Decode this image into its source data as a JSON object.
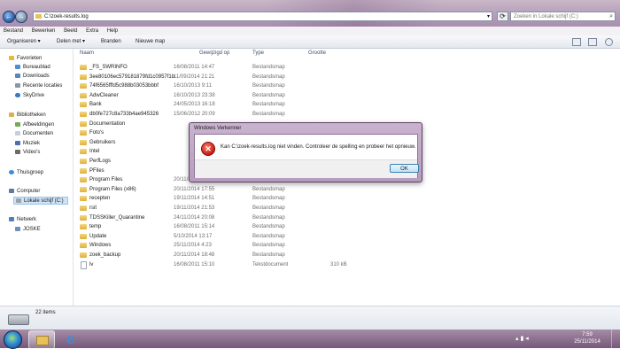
{
  "address": {
    "path": "C:\\zoek-results.log"
  },
  "search": {
    "placeholder": "Zoeken in Lokale schijf (C:)"
  },
  "menu": [
    "Bestand",
    "Bewerken",
    "Beeld",
    "Extra",
    "Help"
  ],
  "toolbar": {
    "organize": "Organiseren ▾",
    "share": "Delen met ▾",
    "burn": "Branden",
    "new_folder": "Nieuwe map"
  },
  "nav": {
    "favorites": "Favorieten",
    "fav_items": [
      "Bureaublad",
      "Downloads",
      "Recente locaties",
      "SkyDrive"
    ],
    "libraries": "Bibliotheken",
    "lib_items": [
      "Afbeeldingen",
      "Documenten",
      "Muziek",
      "Video's"
    ],
    "homegroup": "Thuisgroep",
    "computer": "Computer",
    "drive": "Lokale schijf (C:)",
    "network": "Netwerk",
    "net_items": [
      "JOSKE"
    ]
  },
  "columns": {
    "name": "Naam",
    "date": "Gewijzigd op",
    "type": "Type",
    "size": "Grootte"
  },
  "files": [
    {
      "name": "_FS_SWRINFO",
      "date": "16/08/2011 14:47",
      "type": "Bestandsmap",
      "size": ""
    },
    {
      "name": "3ee80106ec579181879fd1c0957f1b",
      "date": "11/09/2014 21:21",
      "type": "Bestandsmap",
      "size": ""
    },
    {
      "name": "74f6565fffd5c988b03053bbbf",
      "date": "16/10/2013 9:11",
      "type": "Bestandsmap",
      "size": ""
    },
    {
      "name": "AdwCleaner",
      "date": "16/10/2013 23:38",
      "type": "Bestandsmap",
      "size": ""
    },
    {
      "name": "Bank",
      "date": "24/05/2013 16:18",
      "type": "Bestandsmap",
      "size": ""
    },
    {
      "name": "db0fe727c8a733b4ae945326",
      "date": "15/06/2012 20:09",
      "type": "Bestandsmap",
      "size": ""
    },
    {
      "name": "Documentation",
      "date": "",
      "type": "",
      "size": ""
    },
    {
      "name": "Foto's",
      "date": "",
      "type": "",
      "size": ""
    },
    {
      "name": "Gebruikers",
      "date": "",
      "type": "",
      "size": ""
    },
    {
      "name": "Intel",
      "date": "",
      "type": "",
      "size": ""
    },
    {
      "name": "PerfLogs",
      "date": "",
      "type": "",
      "size": ""
    },
    {
      "name": "PFiles",
      "date": "",
      "type": "",
      "size": ""
    },
    {
      "name": "Program Files",
      "date": "20/11/2014 17:55",
      "type": "Bestandsmap",
      "size": ""
    },
    {
      "name": "Program Files (x86)",
      "date": "20/11/2014 17:55",
      "type": "Bestandsmap",
      "size": ""
    },
    {
      "name": "recepten",
      "date": "19/11/2014 14:51",
      "type": "Bestandsmap",
      "size": ""
    },
    {
      "name": "rsit",
      "date": "19/11/2014 21:53",
      "type": "Bestandsmap",
      "size": ""
    },
    {
      "name": "TDSSKiller_Quarantine",
      "date": "24/11/2014 20:08",
      "type": "Bestandsmap",
      "size": ""
    },
    {
      "name": "temp",
      "date": "16/08/2011 15:14",
      "type": "Bestandsmap",
      "size": ""
    },
    {
      "name": "Update",
      "date": "5/10/2014 13:17",
      "type": "Bestandsmap",
      "size": ""
    },
    {
      "name": "Windows",
      "date": "25/11/2014 4:23",
      "type": "Bestandsmap",
      "size": ""
    },
    {
      "name": "zoek_backup",
      "date": "20/11/2014 18:48",
      "type": "Bestandsmap",
      "size": ""
    },
    {
      "name": "lv",
      "date": "16/08/2011 15:10",
      "type": "Tekstdocument",
      "size": "310 kB"
    }
  ],
  "status": {
    "count": "22 items"
  },
  "dialog": {
    "title": "Windows Verkenner",
    "message": "Kan C:\\zoek-results.log niet vinden. Controleer de spelling en probeer het opnieuw.",
    "ok": "OK"
  },
  "taskbar": {
    "time": "7:59",
    "date": "25/11/2014"
  }
}
